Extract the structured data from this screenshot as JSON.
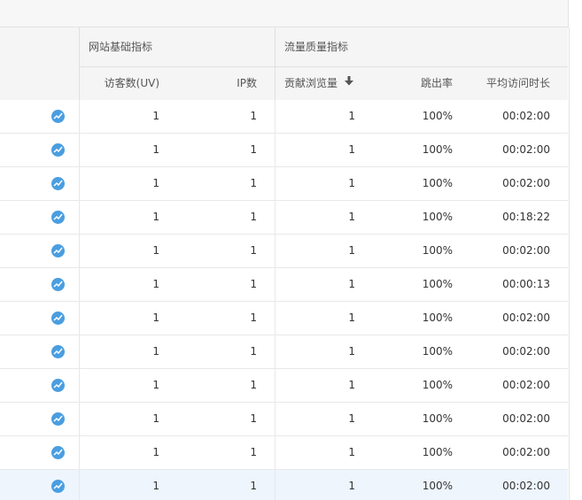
{
  "header": {
    "group_site": "网站基础指标",
    "group_quality": "流量质量指标",
    "col_uv": "访客数(UV)",
    "col_ip": "IP数",
    "col_pv": "贡献浏览量",
    "col_bounce": "跳出率",
    "col_duration": "平均访问时长"
  },
  "rows": [
    {
      "uv": "1",
      "ip": "1",
      "pv": "1",
      "bounce": "100%",
      "duration": "00:02:00"
    },
    {
      "uv": "1",
      "ip": "1",
      "pv": "1",
      "bounce": "100%",
      "duration": "00:02:00"
    },
    {
      "uv": "1",
      "ip": "1",
      "pv": "1",
      "bounce": "100%",
      "duration": "00:02:00"
    },
    {
      "uv": "1",
      "ip": "1",
      "pv": "1",
      "bounce": "100%",
      "duration": "00:18:22"
    },
    {
      "uv": "1",
      "ip": "1",
      "pv": "1",
      "bounce": "100%",
      "duration": "00:02:00"
    },
    {
      "uv": "1",
      "ip": "1",
      "pv": "1",
      "bounce": "100%",
      "duration": "00:00:13"
    },
    {
      "uv": "1",
      "ip": "1",
      "pv": "1",
      "bounce": "100%",
      "duration": "00:02:00"
    },
    {
      "uv": "1",
      "ip": "1",
      "pv": "1",
      "bounce": "100%",
      "duration": "00:02:00"
    },
    {
      "uv": "1",
      "ip": "1",
      "pv": "1",
      "bounce": "100%",
      "duration": "00:02:00"
    },
    {
      "uv": "1",
      "ip": "1",
      "pv": "1",
      "bounce": "100%",
      "duration": "00:02:00"
    },
    {
      "uv": "1",
      "ip": "1",
      "pv": "1",
      "bounce": "100%",
      "duration": "00:02:00"
    },
    {
      "uv": "1",
      "ip": "1",
      "pv": "1",
      "bounce": "100%",
      "duration": "00:02:00"
    }
  ],
  "icons": {
    "trend": "trend-chart-icon",
    "sort": "sort-descending-icon"
  },
  "colors": {
    "trend_icon": "#4a9ee0",
    "highlight_row": "#eef5fd",
    "header_bg": "#f5f5f5"
  }
}
